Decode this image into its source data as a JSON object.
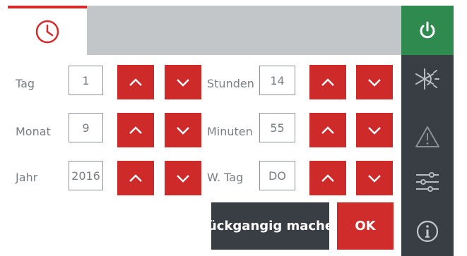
{
  "header": {
    "active_tab_icon": "clock-icon",
    "accent_color": "#d32a2a"
  },
  "sidebar": {
    "items": [
      {
        "icon": "power-icon",
        "active": true,
        "color": "#2f8a4f"
      },
      {
        "icon": "sun-snowflake-icon"
      },
      {
        "icon": "warning-icon"
      },
      {
        "icon": "sliders-icon"
      },
      {
        "icon": "info-icon"
      }
    ]
  },
  "date": {
    "day": {
      "label": "Tag",
      "value": "1"
    },
    "month": {
      "label": "Monat",
      "value": "9"
    },
    "year": {
      "label": "Jahr",
      "value": "2016"
    }
  },
  "time": {
    "hours": {
      "label": "Stunden",
      "value": "14"
    },
    "minutes": {
      "label": "Minuten",
      "value": "55"
    },
    "weekday": {
      "label": "W. Tag",
      "value": "DO"
    }
  },
  "actions": {
    "undo_label": "Rückgangig machen",
    "ok_label": "OK"
  }
}
